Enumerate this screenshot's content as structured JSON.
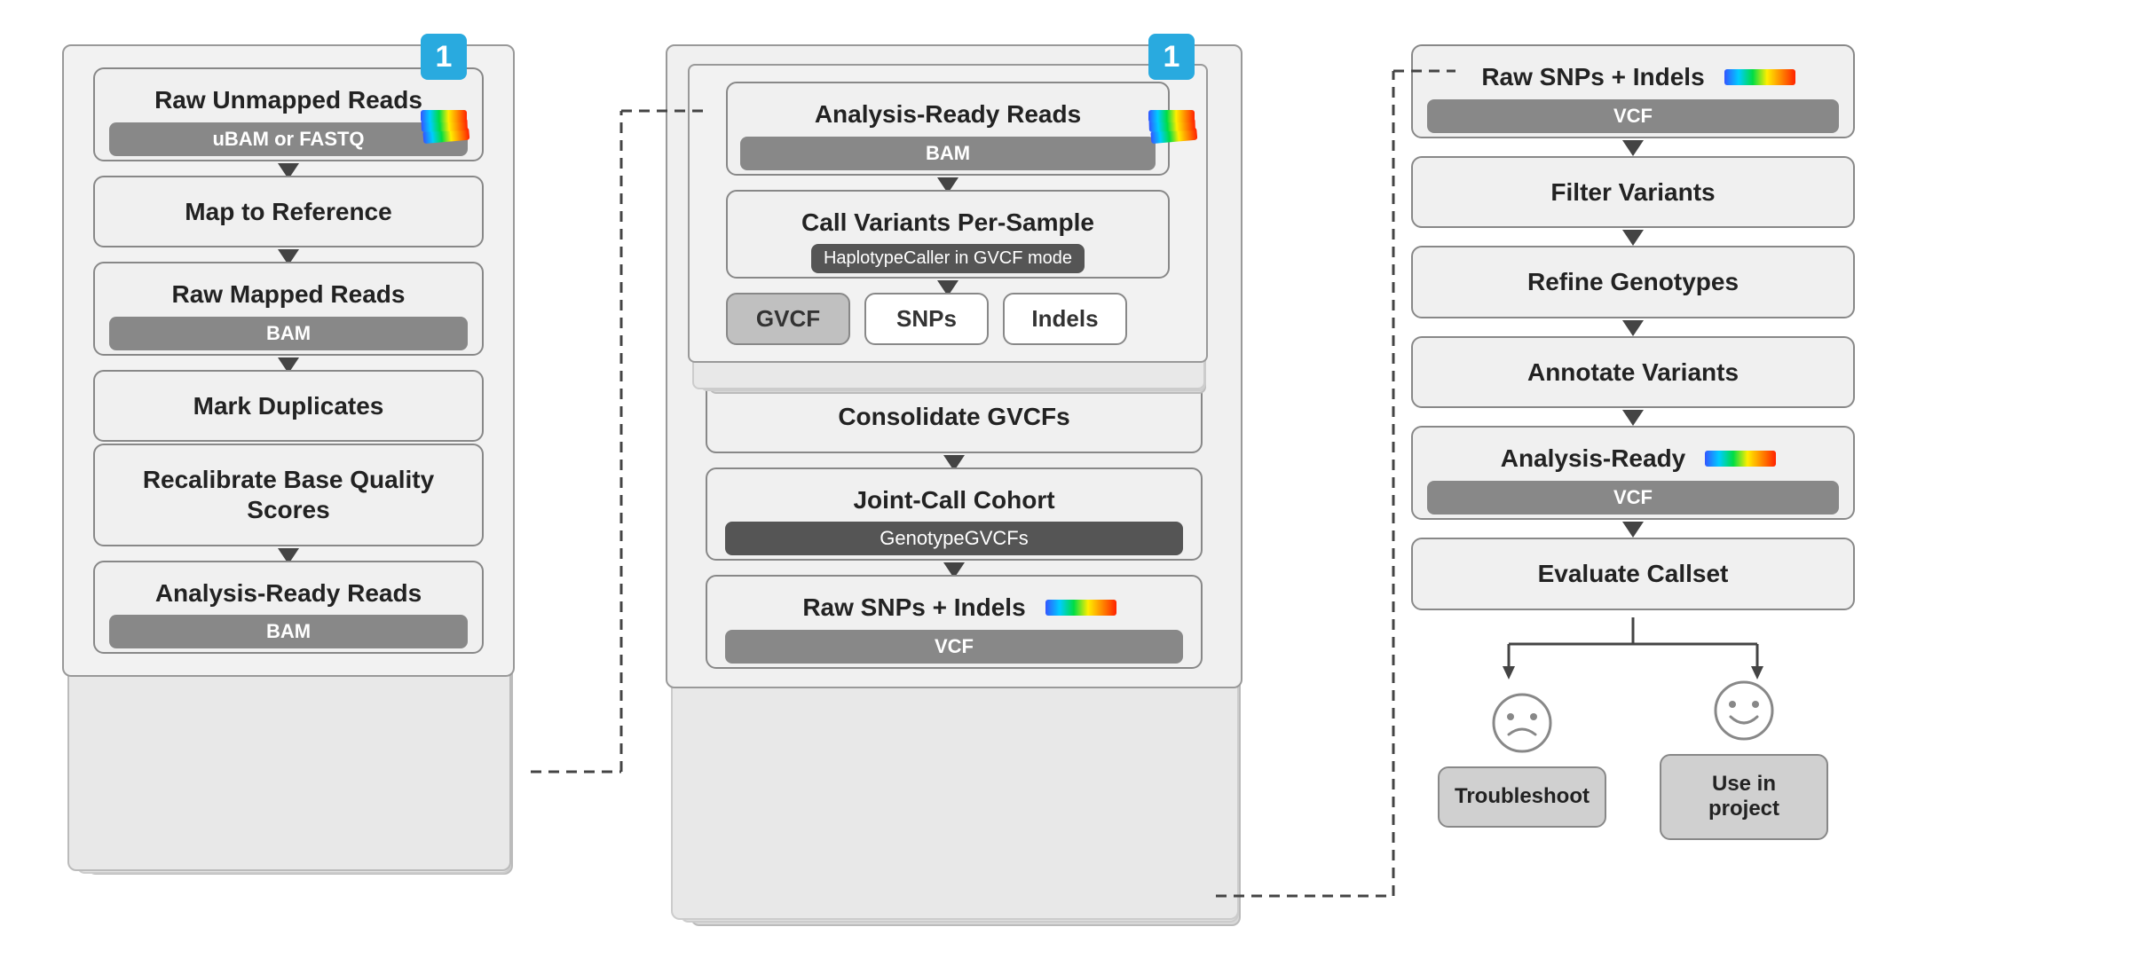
{
  "col1": {
    "badge": "1",
    "boxes": [
      {
        "title": "Raw Unmapped Reads",
        "sub": "uBAM or FASTQ"
      },
      {
        "title": "Map to Reference",
        "sub": null
      },
      {
        "title": "Raw Mapped Reads",
        "sub": "BAM"
      },
      {
        "title": "Mark Duplicates",
        "sub": null
      },
      {
        "title": "Recalibrate Base Quality Scores",
        "sub": null
      },
      {
        "title": "Analysis-Ready Reads",
        "sub": "BAM"
      }
    ]
  },
  "col2": {
    "badge": "1",
    "inner": {
      "title": "Analysis-Ready Reads",
      "sub": "BAM",
      "step1_title": "Call Variants Per-Sample",
      "step1_sub": "HaplotypeCaller in GVCF mode",
      "gvcf": "GVCF",
      "snps": "SNPs",
      "indels": "Indels"
    },
    "consolidate": "Consolidate GVCFs",
    "jointcall_title": "Joint-Call Cohort",
    "jointcall_sub": "GenotypeGVCFs",
    "raw_snps": "Raw SNPs + Indels",
    "raw_snps_sub": "VCF"
  },
  "col3": {
    "raw_snps": "Raw SNPs + Indels",
    "raw_snps_sub": "VCF",
    "filter": "Filter Variants",
    "refine": "Refine Genotypes",
    "annotate": "Annotate Variants",
    "analysis_ready": "Analysis-Ready",
    "analysis_ready_sub": "VCF",
    "evaluate": "Evaluate Callset",
    "troubleshoot": "Troubleshoot",
    "use_in_project": "Use in project"
  },
  "arrows": {
    "down": "↓"
  }
}
